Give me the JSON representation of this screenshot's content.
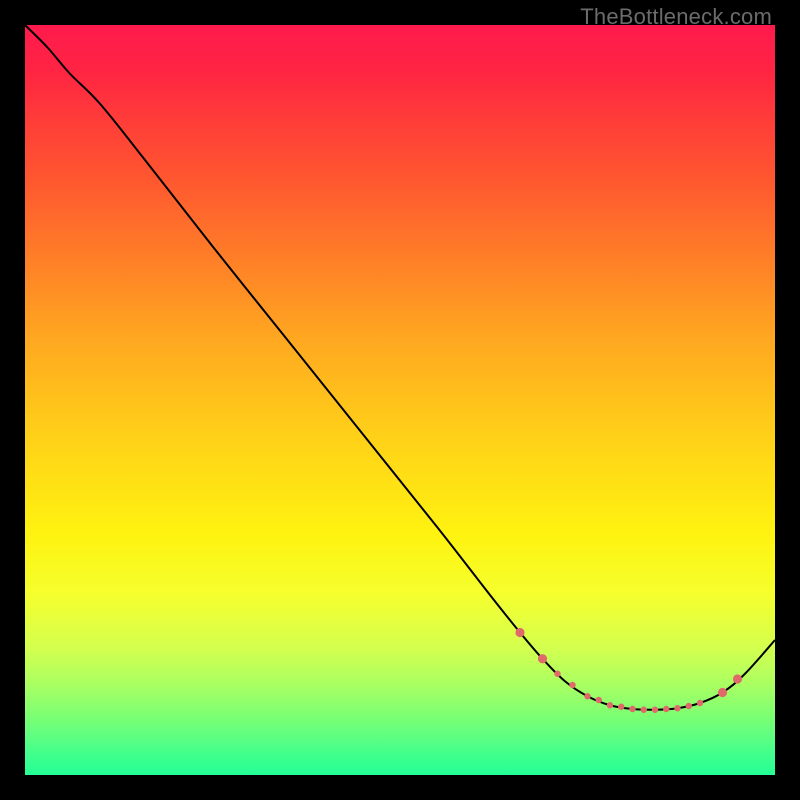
{
  "watermark": "TheBottleneck.com",
  "chart_data": {
    "type": "line",
    "title": "",
    "xlabel": "",
    "ylabel": "",
    "xlim": [
      0,
      100
    ],
    "ylim": [
      0,
      100
    ],
    "series": [
      {
        "name": "curve",
        "color": "#000000",
        "x": [
          0,
          3,
          6,
          10,
          16,
          25,
          35,
          45,
          55,
          62,
          66,
          69,
          72,
          75,
          78,
          81,
          84,
          87,
          90,
          93,
          96,
          100
        ],
        "y": [
          100,
          97,
          93.5,
          89.5,
          82,
          70.5,
          58,
          45.5,
          33,
          24,
          19,
          15.5,
          12.5,
          10.5,
          9.3,
          8.8,
          8.7,
          8.9,
          9.6,
          11,
          13.5,
          18
        ]
      }
    ],
    "markers": {
      "color": "#e06a6a",
      "radius_small": 3.2,
      "radius_large": 4.6,
      "x": [
        66,
        69,
        71,
        73,
        75,
        76.5,
        78,
        79.5,
        81,
        82.5,
        84,
        85.5,
        87,
        88.5,
        90,
        93,
        95
      ],
      "y": [
        19,
        15.5,
        13.5,
        12,
        10.5,
        10,
        9.3,
        9.1,
        8.8,
        8.7,
        8.7,
        8.8,
        8.9,
        9.2,
        9.6,
        11,
        12.8
      ],
      "large": [
        1,
        1,
        0,
        0,
        0,
        0,
        0,
        0,
        0,
        0,
        0,
        0,
        0,
        0,
        0,
        1,
        1
      ]
    }
  }
}
